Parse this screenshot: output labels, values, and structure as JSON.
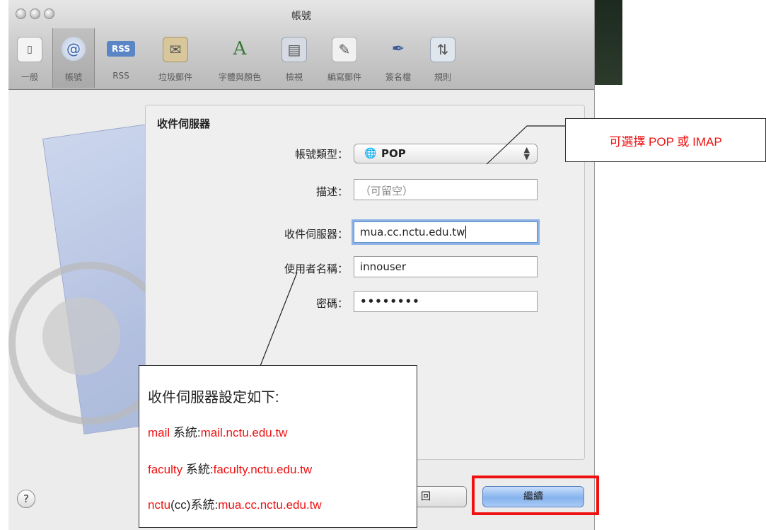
{
  "window": {
    "title": "帳號"
  },
  "toolbar": {
    "items": [
      {
        "label": "一般",
        "icon": "switch-icon"
      },
      {
        "label": "帳號",
        "icon": "at-icon"
      },
      {
        "label": "RSS",
        "icon": "rss-icon"
      },
      {
        "label": "垃圾郵件",
        "icon": "junk-mail-icon"
      },
      {
        "label": "字體與顏色",
        "icon": "font-icon"
      },
      {
        "label": "檢視",
        "icon": "view-icon"
      },
      {
        "label": "編寫郵件",
        "icon": "compose-icon"
      },
      {
        "label": "簽名檔",
        "icon": "signature-icon"
      },
      {
        "label": "規則",
        "icon": "rules-icon"
      }
    ],
    "rss_badge": "RSS",
    "at_glyph": "@",
    "font_glyph": "A"
  },
  "form": {
    "section_title": "收件伺服器",
    "account_type_label": "帳號類型：",
    "account_type_value": "POP",
    "description_label": "描述：",
    "description_placeholder": "（可留空）",
    "server_label": "收件伺服器：",
    "server_value": "mua.cc.nctu.edu.tw",
    "username_label": "使用者名稱：",
    "username_value": "innouser",
    "password_label": "密碼：",
    "password_value": "••••••••"
  },
  "buttons": {
    "help": "?",
    "back": "回",
    "continue": "繼續"
  },
  "annotations": {
    "account_type_note": "可選擇 POP 或 IMAP",
    "server_note_title": "收件伺服器設定如下:",
    "lines": [
      {
        "name": "mail",
        "sys": " 系統:",
        "host": "mail.nctu.edu.tw"
      },
      {
        "name": "faculty",
        "sys": " 系統:",
        "host": "faculty.nctu.edu.tw"
      },
      {
        "name": "nctu",
        "mid": "(cc)",
        "sys": "系統:",
        "host": "mua.cc.nctu.edu.tw"
      }
    ]
  },
  "colors": {
    "annotation_red": "#e11111",
    "focus_ring": "#8db2e4",
    "default_button": "#86b3ee"
  }
}
